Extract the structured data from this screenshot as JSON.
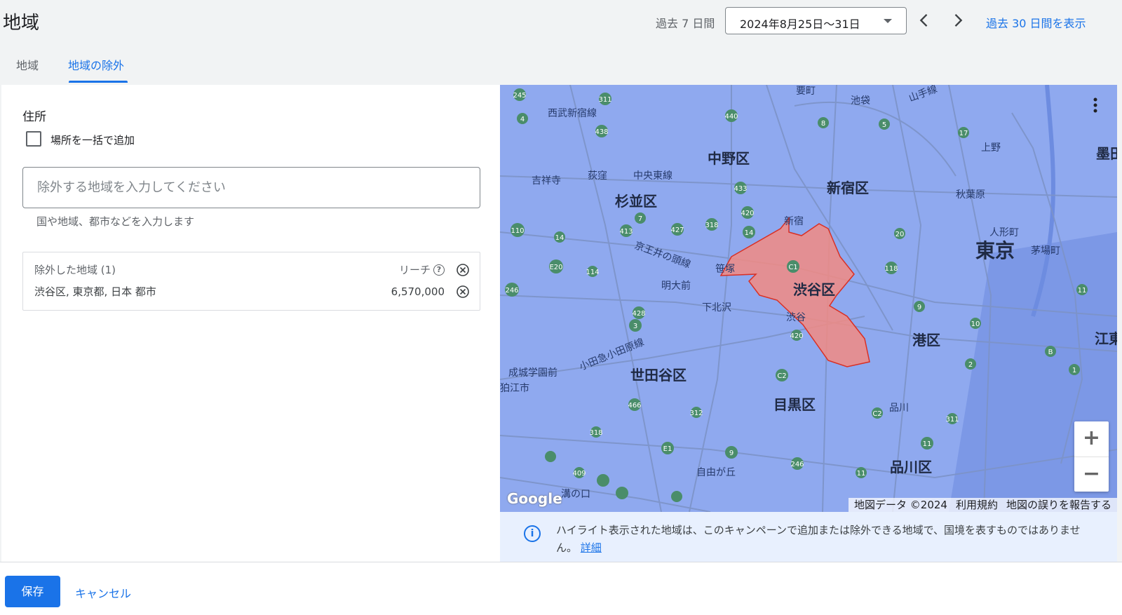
{
  "header": {
    "title": "地域",
    "range_label": "過去 7 日間",
    "date_range": "2024年8月25日〜31日",
    "show_30_days": "過去 30 日間を表示"
  },
  "tabs": [
    {
      "label": "地域",
      "active": false
    },
    {
      "label": "地域の除外",
      "active": true
    }
  ],
  "form": {
    "address_label": "住所",
    "bulk_add_label": "場所を一括で追加",
    "bulk_add_checked": false,
    "search_placeholder": "除外する地域を入力してください",
    "search_value": "",
    "helper_text": "国や地域、都市などを入力します"
  },
  "excluded": {
    "header": "除外した地域 (1)",
    "reach_label": "リーチ",
    "items": [
      {
        "name": "渋谷区, 東京都, 日本 都市",
        "reach": "6,570,000"
      }
    ]
  },
  "map": {
    "labels": {
      "nakano": "中野区",
      "shinjuku": "新宿区",
      "suginami": "杉並区",
      "shibuya": "渋谷区",
      "tokyo": "東京",
      "minato": "港区",
      "setagaya": "世田谷区",
      "meguro": "目黒区",
      "shinagawa": "品川区",
      "seibu": "西武新宿線",
      "kichijoji": "吉祥寺",
      "ogikubo": "荻窪",
      "chuo_line": "中央東線",
      "keio": "京王井の頭線",
      "sasazuka": "笹塚",
      "meidaimae": "明大前",
      "shimokitazawa": "下北沢",
      "odakyu": "小田急小田原線",
      "seijo": "成城学園前",
      "komae": "狛江市",
      "jiyugaoka": "自由が丘",
      "mizonokuchi": "溝の口",
      "ueno": "上野",
      "akihabara": "秋葉原",
      "ningyocho": "人形町",
      "kayabacho": "茅場町",
      "shinagawa_st": "品川",
      "ikebukuro": "池袋",
      "shinjuku_st": "新宿",
      "shibuya_st": "渋谷",
      "koto": "江東",
      "sumida": "墨田",
      "yamanote": "山手線",
      "kanamecho": "要町"
    },
    "route_numbers": [
      "245",
      "311",
      "440",
      "4",
      "438",
      "8",
      "17",
      "5",
      "433",
      "420",
      "318",
      "14",
      "413",
      "427",
      "7",
      "110",
      "14",
      "20",
      "E20",
      "114",
      "246",
      "118",
      "428",
      "3",
      "420",
      "C2",
      "C1",
      "9",
      "10",
      "11",
      "B",
      "2",
      "1",
      "C2",
      "311",
      "11",
      "466",
      "312",
      "318",
      "E1",
      "9",
      "246",
      "409",
      "11"
    ],
    "zoom_in": "+",
    "zoom_out": "−",
    "attribution": [
      "地図データ ©2024",
      "利用規約",
      "地図の誤りを報告する"
    ],
    "logo": "Google"
  },
  "info": {
    "text": "ハイライト表示された地域は、このキャンペーンで追加または除外できる地域で、国境を表すものではありません。",
    "link": "詳細"
  },
  "footer": {
    "save": "保存",
    "cancel": "キャンセル"
  },
  "colors": {
    "accent": "#1a73e8",
    "map_water": "#8fa9ef",
    "excluded_region": "#f28b82"
  }
}
